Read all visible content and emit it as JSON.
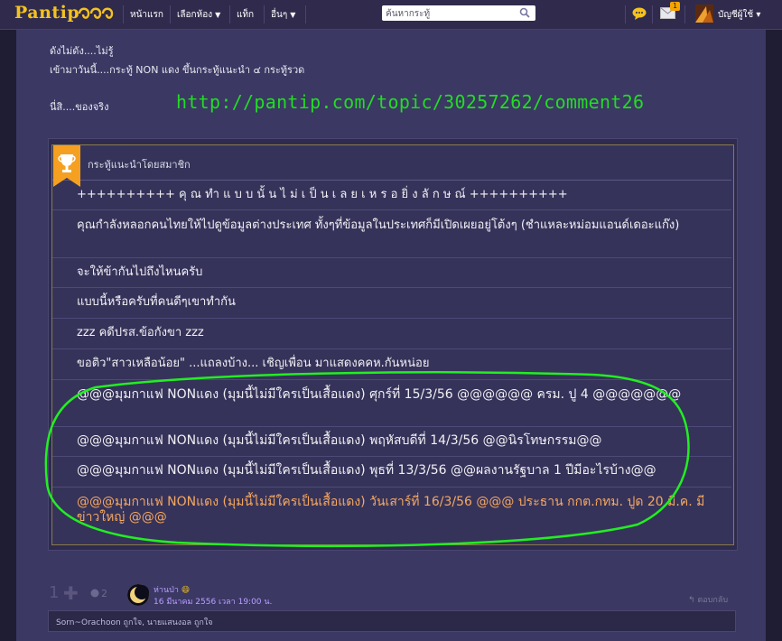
{
  "header": {
    "logo": "Pantip",
    "nav": [
      {
        "label": "หน้าแรก",
        "arrow": ""
      },
      {
        "label": "เลือกห้อง",
        "arrow": "▼"
      },
      {
        "label": "แท็ก",
        "arrow": ""
      },
      {
        "label": "อื่นๆ",
        "arrow": "▼"
      }
    ],
    "search_placeholder": "ค้นหากระทู้",
    "mail_badge": "1",
    "user_label": "บัญชีผู้ใช้ ▾",
    "icons": [
      "search-icon",
      "chat-icon",
      "mail-icon"
    ]
  },
  "post": {
    "line1": "ดังไม่ดัง....ไม่รู้",
    "line2": "เข้ามาวันนี้....กระทู้ NON แดง ขึ้นกระทู้แนะนำ ๔ กระทู้รวด",
    "line3": "นี่สิ....ของจริง",
    "link": "http://pantip.com/topic/30257262/comment26"
  },
  "recommended": {
    "title": "กระทู้แนะนำโดยสมาชิก",
    "items": [
      "++++++++++ คุ ณ ทำ แ บ บ นั้ น ไ ม่ เ ป็ น เ ล ย เ ห ร อ ยิ่ ง ลั ก ษ ณ์ ++++++++++",
      "คุณกำลังหลอกคนไทยให้ไปดูข้อมูลต่างประเทศ ทั้งๆที่ข้อมูลในประเทศก็มีเปิดเผยอยู่โต้งๆ (ชำแหละหม่อมแอนด์เดอะแก๊ง)",
      "จะให้ข้ากันไปถึงไหนครับ",
      "แบบนี้หรือครับที่คนดีๆเขาทำกัน",
      "zzz คดีปรส.ข้อกังขา zzz",
      "ขอติว\"สาวเหลือน้อย\" ...แถลงบ้าง... เชิญเพื่อน มาแสดงคคห.กันหน่อย",
      "@@@มุมกาแฟ NONแดง (มุมนี้ไม่มีใครเป็นเสื้อแดง) ศุกร์ที่ 15/3/56 @@@@@@ ครม. ปู 4 @@@@@@@",
      "@@@มุมกาแฟ NONแดง (มุมนี้ไม่มีใครเป็นเสื้อแดง) พฤหัสบดีที่ 14/3/56 @@นิรโทษกรรม@@",
      "@@@มุมกาแฟ NONแดง (มุมนี้ไม่มีใครเป็นเสื้อแดง) พุธที่ 13/3/56 @@ผลงานรัฐบาล 1 ปีมีอะไรบ้าง@@",
      "@@@มุมกาแฟ NONแดง (มุมนี้ไม่มีใครเป็นเสื้อแดง) วันเสาร์ที่ 16/3/56 @@@ ประธาน กกต.กทม. ปูด 20 มี.ค. มีข่าวใหญ่ @@@"
    ]
  },
  "comment": {
    "votes": "1",
    "emotions": "2",
    "username": "ห่านป่า",
    "date": "16 มีนาคม 2556 เวลา 19:00 น.",
    "reply": "ตอบกลับ",
    "likes": "Sorn~Orachoon ถูกใจ, นายแสนงอล ถูกใจ"
  },
  "colors": {
    "link_green": "#22dd22",
    "visited_orange": "#f5a860",
    "logo_yellow": "#f4c21f"
  }
}
